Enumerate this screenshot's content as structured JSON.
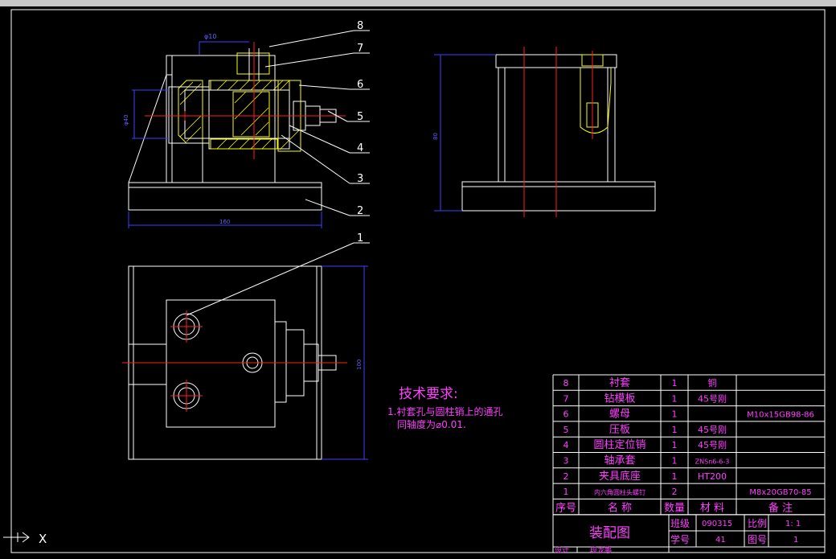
{
  "balloons": [
    "8",
    "7",
    "6",
    "5",
    "4",
    "3",
    "2",
    "1"
  ],
  "dims": {
    "hole": "φ10",
    "front_h": "φ40",
    "base_w": "160",
    "side_h": "80",
    "top_h": "100"
  },
  "notes": {
    "title": "技术要求:",
    "line1": "1.衬套孔与圆柱销上的通孔",
    "line2": "同轴度为⌀0.01."
  },
  "bom": {
    "rows": [
      {
        "no": "8",
        "name": "衬套",
        "qty": "1",
        "mat": "铜",
        "remark": ""
      },
      {
        "no": "7",
        "name": "钻模板",
        "qty": "1",
        "mat": "45号刚",
        "remark": ""
      },
      {
        "no": "6",
        "name": "螺母",
        "qty": "1",
        "mat": "",
        "remark": "M10x15GB98-86"
      },
      {
        "no": "5",
        "name": "压板",
        "qty": "1",
        "mat": "45号刚",
        "remark": ""
      },
      {
        "no": "4",
        "name": "圆柱定位销",
        "qty": "1",
        "mat": "45号刚",
        "remark": ""
      },
      {
        "no": "3",
        "name": "轴承套",
        "qty": "1",
        "mat": "ZNSn6-6-3",
        "remark": ""
      },
      {
        "no": "2",
        "name": "夹具底座",
        "qty": "1",
        "mat": "HT200",
        "remark": ""
      },
      {
        "no": "1",
        "name": "内六角圆柱头螺钉",
        "qty": "2",
        "mat": "",
        "remark": "M8x20GB70-85"
      }
    ],
    "headers": {
      "no": "序号",
      "name": "名  称",
      "qty": "数量",
      "mat": "材 料",
      "remark": "备  注"
    }
  },
  "titleblock": {
    "drawing_title": "装配图",
    "class_label": "班级",
    "class_value": "090315",
    "scale_label": "比例",
    "scale_value": "1: 1",
    "id_label": "学号",
    "id_value": "41",
    "sheet_label": "图号",
    "sheet_value": "1",
    "design_label": "设计",
    "designer": "段龙鹏"
  },
  "ucs": {
    "x_label": "X"
  }
}
